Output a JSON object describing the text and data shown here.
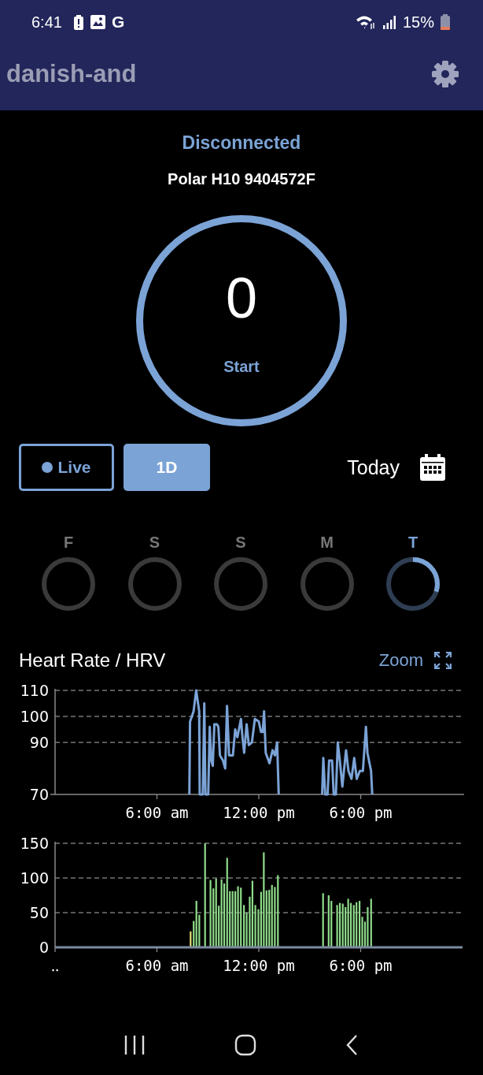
{
  "status_bar": {
    "time": "6:41",
    "notification_letter": "G",
    "battery_percent": "15%"
  },
  "app_bar": {
    "title": "danish-and"
  },
  "device": {
    "status": "Disconnected",
    "name": "Polar H10 9404572F",
    "heart_rate": "0",
    "action": "Start"
  },
  "range_buttons": [
    {
      "label": "Live",
      "selected": false,
      "kind": "live"
    },
    {
      "label": "1D",
      "selected": true,
      "kind": "plain"
    }
  ],
  "date_label": "Today",
  "days": [
    {
      "label": "F",
      "selected": false
    },
    {
      "label": "S",
      "selected": false
    },
    {
      "label": "S",
      "selected": false
    },
    {
      "label": "M",
      "selected": false
    },
    {
      "label": "T",
      "selected": true
    }
  ],
  "section": {
    "title": "Heart Rate / HRV",
    "zoom_label": "Zoom"
  },
  "heart_rate_chart": {
    "chart_data": {
      "type": "line",
      "xlim": [
        0,
        24
      ],
      "ylim": [
        70,
        110
      ],
      "xticks": [
        {
          "value": 6,
          "label": "6:00 am"
        },
        {
          "value": 12,
          "label": "12:00 pm"
        },
        {
          "value": 18,
          "label": "6:00 pm"
        }
      ],
      "yticks": [
        70,
        90,
        100,
        110
      ],
      "x": [
        7.91,
        7.95,
        8.16,
        8.31,
        8.49,
        8.52,
        8.7,
        8.79,
        8.86,
        9.02,
        9.11,
        9.2,
        9.29,
        9.38,
        9.53,
        9.62,
        9.71,
        9.89,
        10.02,
        10.13,
        10.25,
        10.47,
        10.61,
        10.74,
        10.86,
        10.95,
        11.05,
        11.14,
        11.28,
        11.41,
        11.59,
        11.77,
        12.0,
        12.13,
        12.23,
        12.31,
        12.41,
        12.63,
        12.81,
        12.95,
        13.08,
        13.17,
        15.73,
        15.8,
        15.91,
        16.05,
        16.14,
        16.32,
        16.41,
        16.54,
        16.65,
        16.77,
        16.92,
        17.14,
        17.28,
        17.46,
        17.62,
        17.77,
        17.95,
        18.13,
        18.31,
        18.4,
        18.61,
        18.68
      ],
      "series": [
        {
          "color": "#7ba3d6",
          "values": [
            70,
            98,
            102,
            110,
            102,
            70,
            70,
            105,
            70,
            70,
            96,
            83,
            81,
            97,
            97,
            96,
            85,
            83,
            80,
            104,
            85,
            85,
            95,
            92,
            96,
            99,
            91,
            86,
            97,
            89,
            90,
            99,
            98,
            94,
            94,
            102,
            86,
            82,
            87,
            85,
            90,
            70,
            70,
            84,
            70,
            70,
            83,
            83,
            70,
            70,
            90,
            83,
            73,
            87,
            79,
            76,
            84,
            76,
            79,
            79,
            96,
            86,
            79,
            70
          ]
        }
      ]
    }
  },
  "hrv_chart": {
    "chart_data": {
      "type": "bar",
      "xlim": [
        0,
        24
      ],
      "ylim": [
        0,
        150
      ],
      "xticks": [
        {
          "value": 0,
          "label": "‥"
        },
        {
          "value": 6,
          "label": "6:00 am"
        },
        {
          "value": 12,
          "label": "12:00 pm"
        },
        {
          "value": 18,
          "label": "6:00 pm"
        }
      ],
      "yticks": [
        0,
        50,
        100,
        150
      ],
      "x": [
        7.98,
        8.16,
        8.32,
        8.49,
        8.83,
        9.15,
        9.32,
        9.48,
        9.64,
        9.8,
        9.96,
        10.13,
        10.29,
        10.45,
        10.61,
        10.77,
        10.94,
        11.12,
        11.28,
        11.46,
        11.62,
        11.79,
        11.97,
        12.13,
        12.29,
        12.45,
        12.61,
        12.77,
        12.94,
        13.12,
        15.78,
        16.11,
        16.27,
        16.61,
        16.77,
        16.94,
        17.1,
        17.26,
        17.42,
        17.59,
        17.75,
        17.93,
        18.09,
        18.25,
        18.41,
        18.61
      ],
      "series": [
        {
          "color": "#e8e07a",
          "values": [
            23,
            null,
            null,
            null,
            null,
            null,
            null,
            null,
            null,
            null,
            null,
            null,
            null,
            null,
            null,
            null,
            null,
            null,
            null,
            null,
            null,
            null,
            null,
            null,
            null,
            null,
            null,
            null,
            null,
            null,
            null,
            null,
            null,
            null,
            null,
            null,
            null,
            null,
            null,
            null,
            null,
            null,
            null,
            null,
            null,
            null
          ]
        },
        {
          "color": "#8fdc8a",
          "values": [
            null,
            38,
            67,
            47,
            150,
            97,
            85,
            99,
            60,
            98,
            92,
            129,
            81,
            81,
            81,
            88,
            86,
            61,
            50,
            73,
            96,
            61,
            55,
            80,
            137,
            82,
            83,
            90,
            87,
            104,
            78,
            75,
            67,
            61,
            64,
            63,
            58,
            70,
            64,
            61,
            65,
            67,
            44,
            37,
            58,
            70
          ]
        }
      ]
    }
  }
}
